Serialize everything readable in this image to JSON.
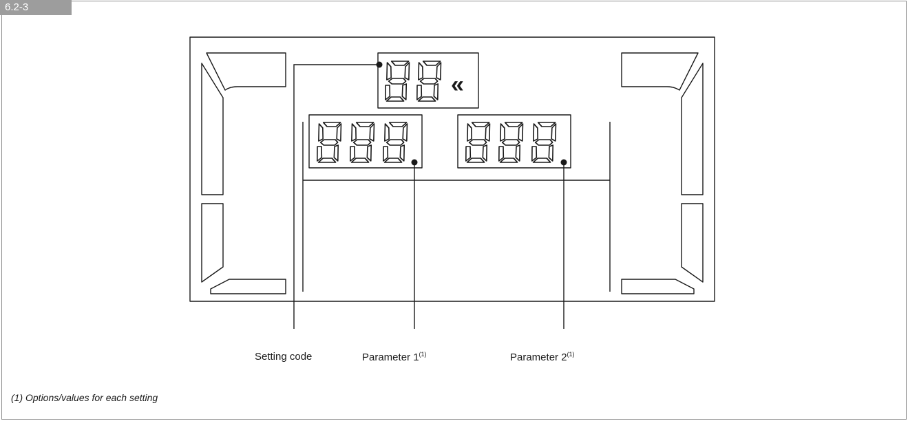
{
  "figure": {
    "tag": "6.2-3"
  },
  "display": {
    "setting_code_digits": "88",
    "chevron_glyph": "«",
    "parameter1_digits": "888",
    "parameter2_digits": "888"
  },
  "callouts": {
    "setting_code": "Setting code",
    "parameter1": {
      "text": "Parameter 1",
      "note": "(1)"
    },
    "parameter2": {
      "text": "Parameter 2",
      "note": "(1)"
    }
  },
  "footnote": "(1) Options/values for each setting"
}
